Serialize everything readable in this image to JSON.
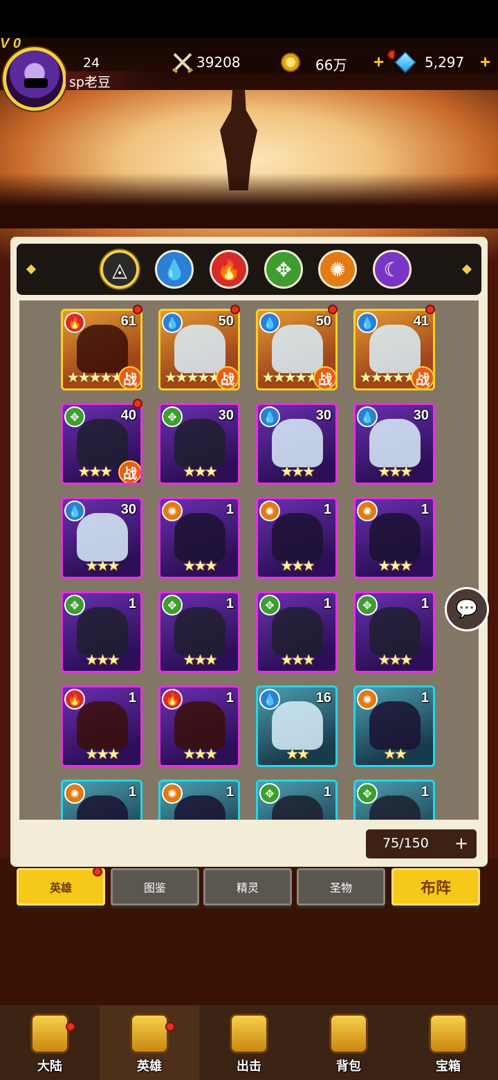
{
  "header": {
    "vip": "V 0",
    "level": "24",
    "player_name": "sp老豆",
    "power": "39208",
    "gold": "66万",
    "gems": "5,297",
    "add": "+"
  },
  "filters": [
    {
      "key": "all",
      "icon": "triangle-icon",
      "glyph": "◬"
    },
    {
      "key": "water",
      "icon": "water-drop-icon",
      "glyph": "💧"
    },
    {
      "key": "fire",
      "icon": "fire-icon",
      "glyph": "🔥"
    },
    {
      "key": "wind",
      "icon": "leaf-icon",
      "glyph": "✥"
    },
    {
      "key": "sun",
      "icon": "sun-icon",
      "glyph": "✺"
    },
    {
      "key": "moon",
      "icon": "moon-icon",
      "glyph": "☾"
    }
  ],
  "heroes": [
    {
      "level": "61",
      "element": "fire",
      "stars": "★★★★★",
      "frame": "gold",
      "battle": "战",
      "dot": true
    },
    {
      "level": "50",
      "element": "water",
      "stars": "★★★★★",
      "frame": "gold",
      "battle": "战",
      "dot": true
    },
    {
      "level": "50",
      "element": "water",
      "stars": "★★★★★",
      "frame": "gold",
      "battle": "战",
      "dot": true
    },
    {
      "level": "41",
      "element": "water",
      "stars": "★★★★★",
      "frame": "gold",
      "battle": "战",
      "dot": true
    },
    {
      "level": "40",
      "element": "wind",
      "stars": "★★★",
      "frame": "purple",
      "battle": "战",
      "dot": true
    },
    {
      "level": "30",
      "element": "wind",
      "stars": "★★★",
      "frame": "purple",
      "battle": "",
      "dot": false
    },
    {
      "level": "30",
      "element": "water",
      "stars": "★★★",
      "frame": "purple",
      "battle": "",
      "dot": false
    },
    {
      "level": "30",
      "element": "water",
      "stars": "★★★",
      "frame": "purple",
      "battle": "",
      "dot": false
    },
    {
      "level": "30",
      "element": "water",
      "stars": "★★★",
      "frame": "purple",
      "battle": "",
      "dot": false
    },
    {
      "level": "1",
      "element": "sun",
      "stars": "★★★",
      "frame": "purple",
      "battle": "",
      "dot": false
    },
    {
      "level": "1",
      "element": "sun",
      "stars": "★★★",
      "frame": "purple",
      "battle": "",
      "dot": false
    },
    {
      "level": "1",
      "element": "sun",
      "stars": "★★★",
      "frame": "purple",
      "battle": "",
      "dot": false
    },
    {
      "level": "1",
      "element": "wind",
      "stars": "★★★",
      "frame": "purple",
      "battle": "",
      "dot": false
    },
    {
      "level": "1",
      "element": "wind",
      "stars": "★★★",
      "frame": "purple",
      "battle": "",
      "dot": false
    },
    {
      "level": "1",
      "element": "wind",
      "stars": "★★★",
      "frame": "purple",
      "battle": "",
      "dot": false
    },
    {
      "level": "1",
      "element": "wind",
      "stars": "★★★",
      "frame": "purple",
      "battle": "",
      "dot": false
    },
    {
      "level": "1",
      "element": "fire",
      "stars": "★★★",
      "frame": "purple",
      "battle": "",
      "dot": false
    },
    {
      "level": "1",
      "element": "fire",
      "stars": "★★★",
      "frame": "purple",
      "battle": "",
      "dot": false
    },
    {
      "level": "16",
      "element": "water",
      "stars": "★★",
      "frame": "cyan",
      "battle": "",
      "dot": false
    },
    {
      "level": "1",
      "element": "sun",
      "stars": "★★",
      "frame": "cyan",
      "battle": "",
      "dot": false
    },
    {
      "level": "1",
      "element": "sun",
      "stars": "",
      "frame": "cyan",
      "battle": "",
      "dot": false
    },
    {
      "level": "1",
      "element": "sun",
      "stars": "",
      "frame": "cyan",
      "battle": "",
      "dot": false
    },
    {
      "level": "1",
      "element": "wind",
      "stars": "",
      "frame": "cyan",
      "battle": "",
      "dot": false
    },
    {
      "level": "1",
      "element": "wind",
      "stars": "",
      "frame": "cyan",
      "battle": "",
      "dot": false
    }
  ],
  "counter": {
    "value": "75/150",
    "plus": "+"
  },
  "tabs": {
    "heroes": "英雄",
    "codex": "图鉴",
    "spirit": "精灵",
    "relic": "圣物",
    "deploy": "布阵"
  },
  "nav": [
    {
      "label": "大陆",
      "icon": "castle-icon"
    },
    {
      "label": "英雄",
      "icon": "helmet-icon"
    },
    {
      "label": "出击",
      "icon": "crossed-swords-icon"
    },
    {
      "label": "背包",
      "icon": "backpack-icon"
    },
    {
      "label": "宝箱",
      "icon": "treasure-chest-icon"
    }
  ],
  "colors": {
    "accent": "#f6c81a",
    "panel": "#f3ecd6",
    "grid": "#827666",
    "nav": "#3b2414"
  }
}
